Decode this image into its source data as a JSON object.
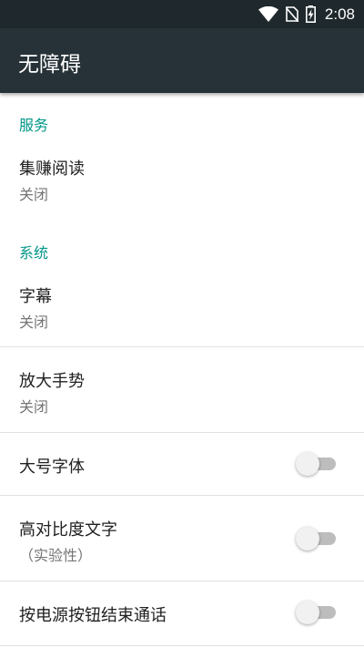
{
  "status_bar": {
    "time": "2:08",
    "icons": [
      "wifi-icon",
      "no-sim-icon",
      "battery-charging-icon"
    ]
  },
  "toolbar": {
    "title": "无障碍"
  },
  "sections": {
    "services": {
      "header": "服务",
      "items": [
        {
          "title": "集赚阅读",
          "summary": "关闭"
        }
      ]
    },
    "system": {
      "header": "系统",
      "items": [
        {
          "title": "字幕",
          "summary": "关闭"
        },
        {
          "title": "放大手势",
          "summary": "关闭"
        },
        {
          "title": "大号字体",
          "switch_on": false
        },
        {
          "title": "高对比度文字",
          "summary": "（实验性）",
          "switch_on": false
        },
        {
          "title": "按电源按钮结束通话",
          "switch_on": false
        }
      ]
    }
  },
  "colors": {
    "status_bar": "#1f292d",
    "toolbar": "#263238",
    "accent": "#009688",
    "switch_off_track": "#bdbdbd",
    "switch_off_thumb": "#f1f1f1"
  }
}
